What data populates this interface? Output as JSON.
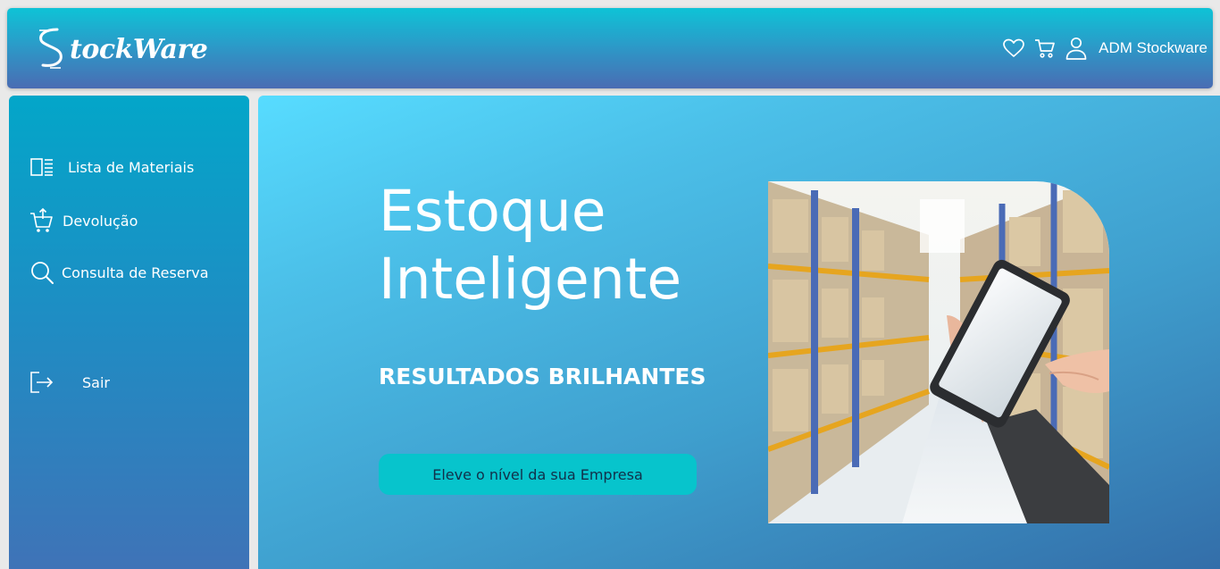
{
  "brand": {
    "logo_text": "tockWare"
  },
  "header": {
    "user_name": "ADM Stockware",
    "icons": [
      "heart-icon",
      "cart-icon",
      "user-icon"
    ]
  },
  "sidebar": {
    "items": [
      {
        "label": "Lista de Materiais",
        "icon": "list-icon"
      },
      {
        "label": "Devolução",
        "icon": "cart-return-icon"
      },
      {
        "label": "Consulta de Reserva",
        "icon": "search-icon"
      },
      {
        "label": "Sair",
        "icon": "logout-icon"
      }
    ]
  },
  "hero": {
    "title_line1": "Estoque",
    "title_line2": "Inteligente",
    "subtitle": "RESULTADOS BRILHANTES",
    "cta_label": "Eleve o nível da sua Empresa"
  },
  "colors": {
    "header_top": "#0ec3d6",
    "header_bottom": "#4a6cb3",
    "sidebar_top": "#03a6c9",
    "sidebar_bottom": "#3f73b7",
    "hero_top": "#57dcff",
    "hero_bottom": "#336ea9",
    "cta_bg": "#07c4cc"
  }
}
